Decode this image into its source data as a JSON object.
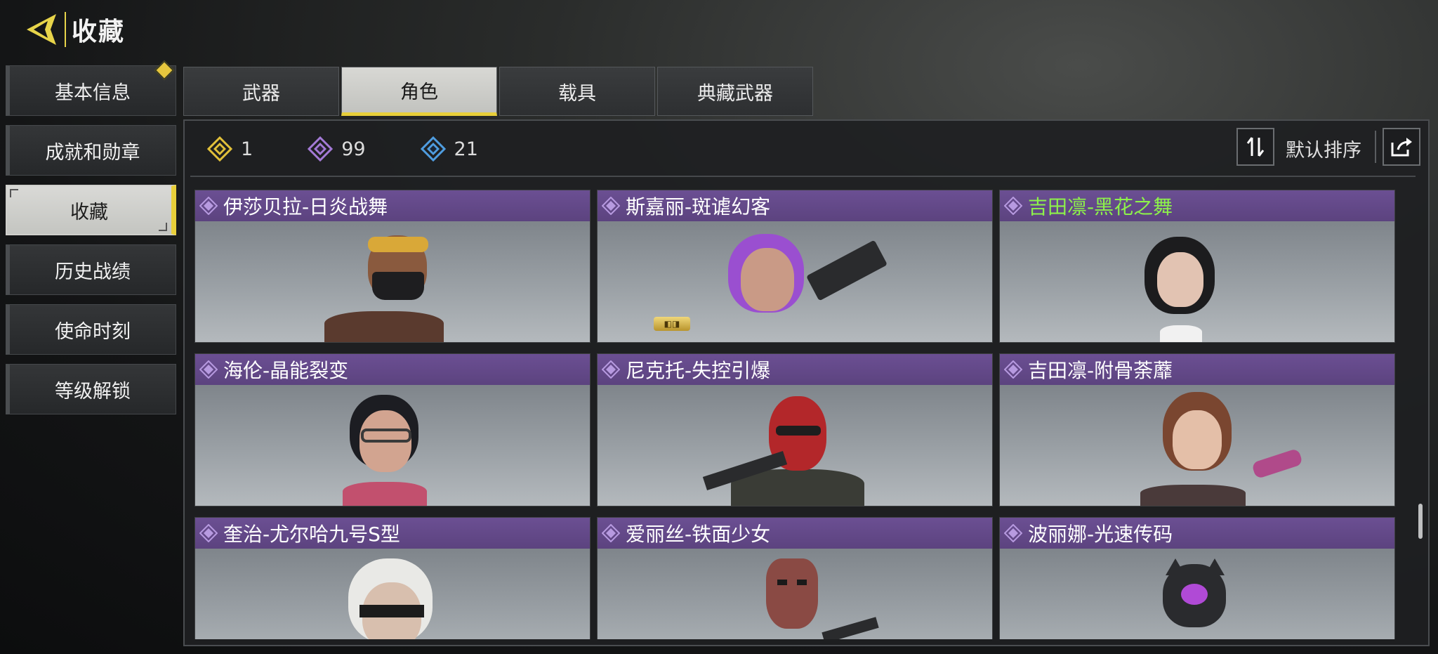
{
  "header": {
    "title": "收藏"
  },
  "sidebar": {
    "items": [
      {
        "label": "基本信息"
      },
      {
        "label": "成就和勋章"
      },
      {
        "label": "收藏"
      },
      {
        "label": "历史战绩"
      },
      {
        "label": "使命时刻"
      },
      {
        "label": "等级解锁"
      }
    ]
  },
  "tabs": [
    {
      "label": "武器"
    },
    {
      "label": "角色"
    },
    {
      "label": "载具"
    },
    {
      "label": "典藏武器"
    }
  ],
  "counters": [
    {
      "value": "1",
      "color": "#e2c13a",
      "icon": "legendary-diamond-icon"
    },
    {
      "value": "99",
      "color": "#a47ad6",
      "icon": "epic-diamond-icon"
    },
    {
      "value": "21",
      "color": "#4f9de0",
      "icon": "rare-diamond-icon"
    }
  ],
  "sort": {
    "label": "默认排序"
  },
  "cards": [
    {
      "name": "伊莎贝拉-日炎战舞"
    },
    {
      "name": "斯嘉丽-斑谑幻客"
    },
    {
      "name": "吉田凛-黑花之舞",
      "highlight": true
    },
    {
      "name": "海伦-晶能裂变"
    },
    {
      "name": "尼克托-失控引爆"
    },
    {
      "name": "吉田凛-附骨荼蘼"
    },
    {
      "name": "奎治-尤尔哈九号S型"
    },
    {
      "name": "爱丽丝-铁面少女"
    },
    {
      "name": "波丽娜-光速传码"
    }
  ],
  "colors": {
    "accent": "#e8cf3a",
    "card_header": "#62478a",
    "highlight_text": "#8df24a"
  }
}
